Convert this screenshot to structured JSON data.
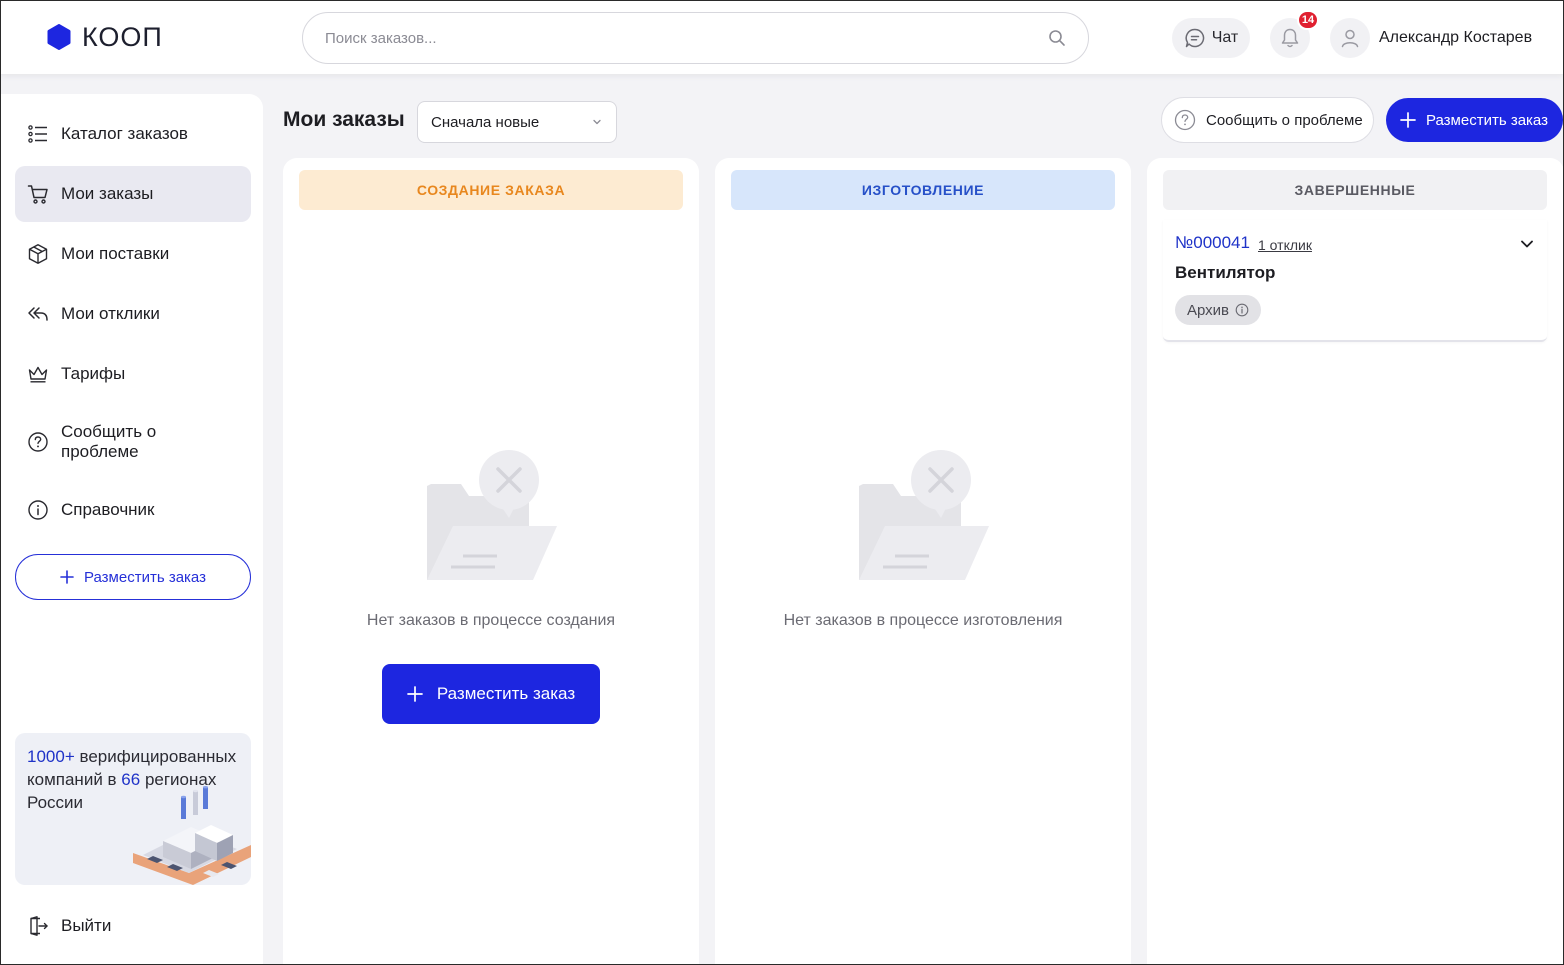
{
  "header": {
    "logo_text": "КООП",
    "search_placeholder": "Поиск заказов...",
    "chat_label": "Чат",
    "notifications_count": "14",
    "user_name": "Александр Костарев"
  },
  "sidebar": {
    "items": [
      {
        "label": "Каталог заказов",
        "icon": "list-icon"
      },
      {
        "label": "Мои заказы",
        "icon": "cart-icon",
        "active": true
      },
      {
        "label": "Мои поставки",
        "icon": "box-icon"
      },
      {
        "label": "Мои отклики",
        "icon": "reply-all-icon"
      },
      {
        "label": "Тарифы",
        "icon": "crown-icon"
      },
      {
        "label": "Сообщить о проблеме",
        "icon": "question-icon"
      },
      {
        "label": "Справочник",
        "icon": "info-icon"
      }
    ],
    "post_order_label": "Разместить заказ",
    "promo": {
      "count": "1000+",
      "text_1": " верифицированных компаний в ",
      "regions": "66",
      "text_2": " регионах России"
    },
    "logout_label": "Выйти"
  },
  "toolbar": {
    "page_title": "Мои заказы",
    "sort_value": "Сначала новые",
    "report_label": "Сообщить о проблеме",
    "post_order_label": "Разместить заказ"
  },
  "columns": {
    "creating": {
      "title": "СОЗДАНИЕ ЗАКАЗА",
      "empty_text": "Нет заказов в процессе создания",
      "post_order_label": "Разместить заказ"
    },
    "manufacturing": {
      "title": "ИЗГОТОВЛЕНИЕ",
      "empty_text": "Нет заказов в процессе изготовления"
    },
    "completed": {
      "title": "ЗАВЕРШЕННЫЕ",
      "orders": [
        {
          "number": "№000041",
          "responses": "1 отклик",
          "name": "Вентилятор",
          "status": "Архив"
        }
      ]
    }
  },
  "colors": {
    "accent": "#1d26e0",
    "creating_bg": "#fdebd2",
    "creating_text": "#e8871e",
    "manufacturing_bg": "#d7e6fb",
    "manufacturing_text": "#2650c8",
    "completed_bg": "#f1f1f3",
    "completed_text": "#5a5a62"
  }
}
